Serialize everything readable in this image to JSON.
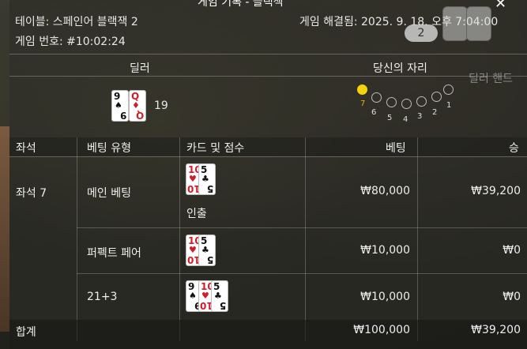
{
  "header": {
    "title": "게임 기록 - 블랙잭",
    "table_label": "테이블: 스페인어 블랙잭 2",
    "round_number": "게임 번호: #10:02:24",
    "resolved": "게임 해결됨: 2025. 9. 18. 오후 7:04:00",
    "hand_count_badge": "2",
    "dealer_hand_label": "딜러 핸드"
  },
  "dealer": {
    "title": "딜러",
    "cards": [
      {
        "rank": "9",
        "suit": "♠",
        "color": "black"
      },
      {
        "rank": "Q",
        "suit": "♦",
        "color": "red"
      }
    ],
    "score": "19"
  },
  "seat_panel": {
    "title": "당신의 자리",
    "seats": [
      {
        "num": "7",
        "active": true
      },
      {
        "num": "6",
        "active": false
      },
      {
        "num": "5",
        "active": false
      },
      {
        "num": "4",
        "active": false
      },
      {
        "num": "3",
        "active": false
      },
      {
        "num": "2",
        "active": false
      },
      {
        "num": "1",
        "active": false
      }
    ],
    "active_color": "#f5d20a"
  },
  "table": {
    "headers": [
      "좌석",
      "베팅 유형",
      "카드 및 점수",
      "베팅",
      "승"
    ],
    "seat": "좌석 7",
    "rows": [
      {
        "bet_type": "메인 베팅",
        "cards": [
          {
            "rank": "10",
            "suit": "♥",
            "color": "red"
          },
          {
            "rank": "5",
            "suit": "♣",
            "color": "black"
          }
        ],
        "note": "인출",
        "bet": "₩80,000",
        "win": "₩39,200"
      },
      {
        "bet_type": "퍼펙트 페어",
        "cards": [
          {
            "rank": "10",
            "suit": "♥",
            "color": "red"
          },
          {
            "rank": "5",
            "suit": "♣",
            "color": "black"
          }
        ],
        "note": "",
        "bet": "₩10,000",
        "win": "₩0"
      },
      {
        "bet_type": "21+3",
        "cards": [
          {
            "rank": "9",
            "suit": "♠",
            "color": "black"
          },
          {
            "rank": "10",
            "suit": "♥",
            "color": "red"
          },
          {
            "rank": "5",
            "suit": "♣",
            "color": "black"
          }
        ],
        "note": "",
        "bet": "₩10,000",
        "win": "₩0"
      }
    ],
    "total_label": "합계",
    "total_bet": "₩100,000",
    "total_win": "₩39,200"
  }
}
